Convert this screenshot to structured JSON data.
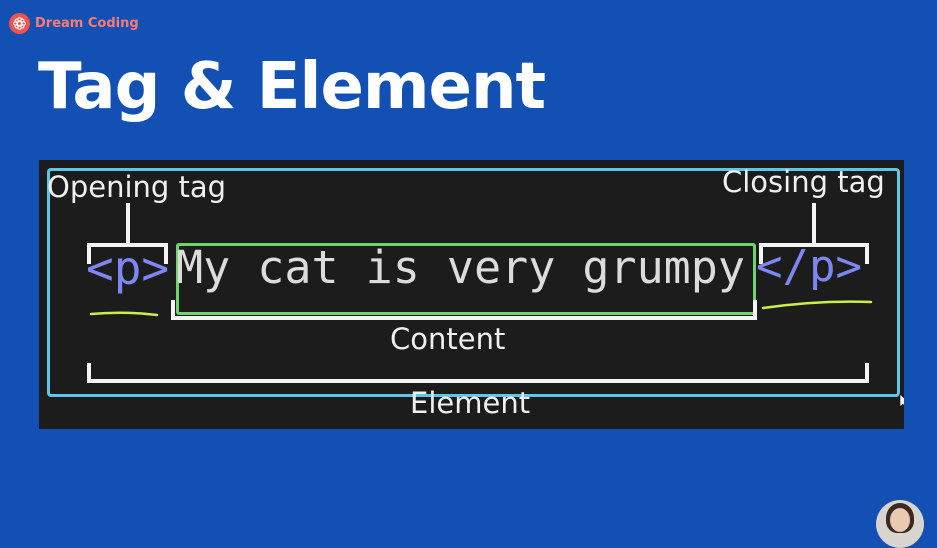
{
  "brand": {
    "name": "Dream Coding",
    "logo_icon": "sun-flower-icon"
  },
  "slide": {
    "title": "Tag & Element"
  },
  "diagram": {
    "opening_tag_label": "Opening tag",
    "closing_tag_label": "Closing tag",
    "content_label": "Content",
    "element_label": "Element",
    "code": {
      "opening_tag": "<p>",
      "content": "My cat is very grumpy",
      "closing_tag": "</p>"
    },
    "colors": {
      "background": "#1c1c1c",
      "tag": "#7d86f2",
      "content": "#dcdcdc",
      "element_outline": "#5bc8e8",
      "content_outline": "#6fd46a",
      "underline": "#c8f048"
    }
  },
  "presenter": {
    "avatar_icon": "presenter-avatar"
  }
}
